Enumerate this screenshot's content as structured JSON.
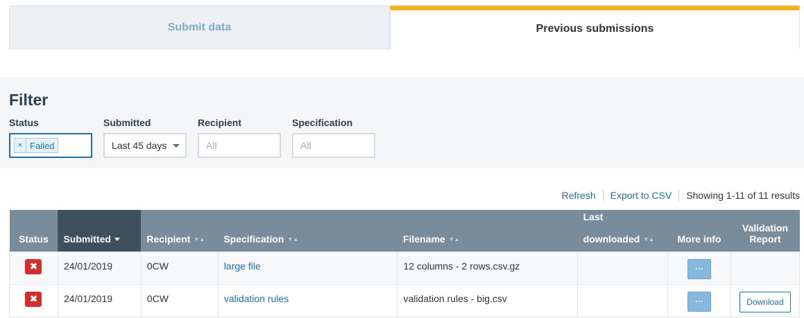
{
  "tabs": [
    {
      "label": "Submit data"
    },
    {
      "label": "Previous submissions"
    }
  ],
  "filter": {
    "title": "Filter",
    "status": {
      "label": "Status",
      "chip": "Failed",
      "chip_remove": "×"
    },
    "submitted": {
      "label": "Submitted",
      "value": "Last 45 days"
    },
    "recipient": {
      "label": "Recipient",
      "placeholder": "All"
    },
    "specification": {
      "label": "Specification",
      "placeholder": "All"
    }
  },
  "toolbar": {
    "refresh": "Refresh",
    "export": "Export to CSV",
    "results": "Showing 1-11 of 11 results"
  },
  "table": {
    "headers": {
      "status": "Status",
      "submitted": "Submitted",
      "recipient": "Recipient",
      "specification": "Specification",
      "filename": "Filename",
      "last_downloaded_1": "Last",
      "last_downloaded_2": "downloaded",
      "more_info": "More info",
      "validation_1": "Validation",
      "validation_2": "Report"
    },
    "rows": [
      {
        "status_icon": "✖",
        "submitted": "24/01/2019",
        "recipient": "0CW",
        "specification": "large file",
        "filename": "12 columns - 2 rows.csv.gz",
        "last_downloaded": "",
        "more": "···",
        "report": ""
      },
      {
        "status_icon": "✖",
        "submitted": "24/01/2019",
        "recipient": "0CW",
        "specification": "validation rules",
        "filename": "validation rules - big.csv",
        "last_downloaded": "",
        "more": "···",
        "report": "Download"
      }
    ]
  },
  "colors": {
    "accent": "#f0b429",
    "header": "#798c9b",
    "header_active": "#3f4f5c",
    "failed": "#d32f2f",
    "link": "#1f6fa8"
  }
}
